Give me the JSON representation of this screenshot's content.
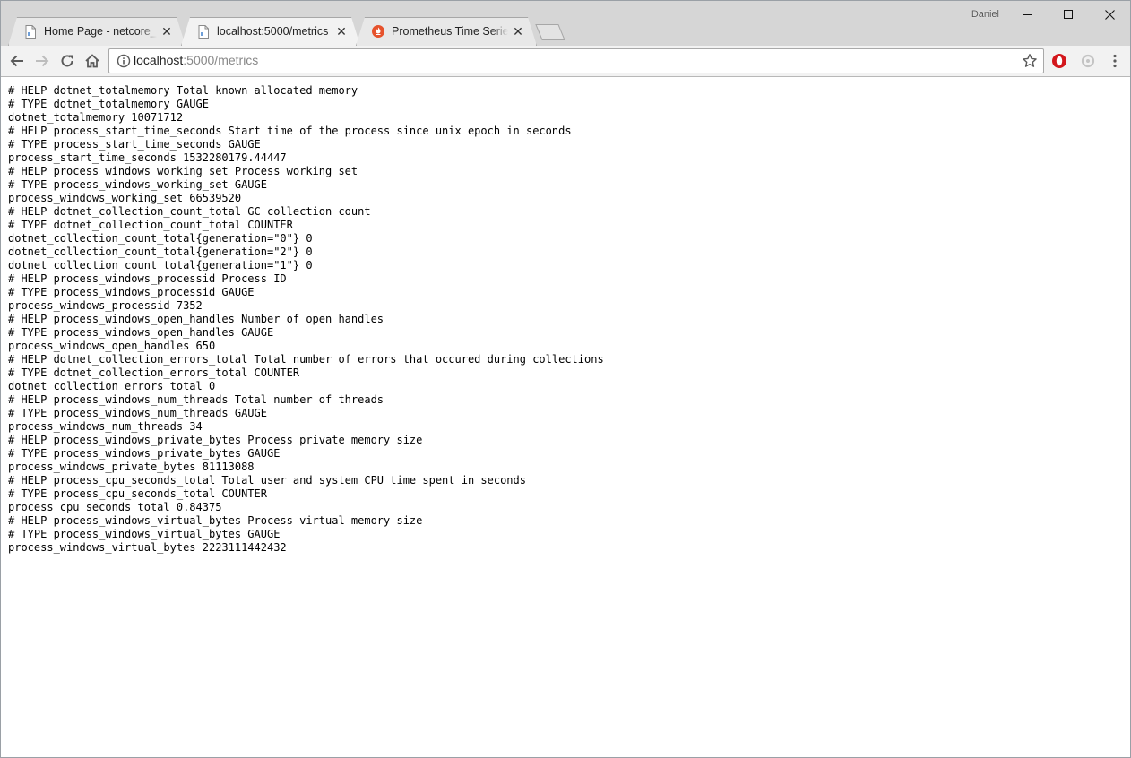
{
  "window": {
    "profile_name": "Daniel"
  },
  "tabs": [
    {
      "title": "Home Page - netcore_prometheus",
      "active": false,
      "favicon": "page-icon"
    },
    {
      "title": "localhost:5000/metrics",
      "active": true,
      "favicon": "page-icon"
    },
    {
      "title": "Prometheus Time Series Collection and Processing Server",
      "active": false,
      "favicon": "prometheus-icon"
    }
  ],
  "address_bar": {
    "host": "localhost",
    "path": ":5000/metrics"
  },
  "metrics_lines": [
    "# HELP dotnet_totalmemory Total known allocated memory",
    "# TYPE dotnet_totalmemory GAUGE",
    "dotnet_totalmemory 10071712",
    "# HELP process_start_time_seconds Start time of the process since unix epoch in seconds",
    "# TYPE process_start_time_seconds GAUGE",
    "process_start_time_seconds 1532280179.44447",
    "# HELP process_windows_working_set Process working set",
    "# TYPE process_windows_working_set GAUGE",
    "process_windows_working_set 66539520",
    "# HELP dotnet_collection_count_total GC collection count",
    "# TYPE dotnet_collection_count_total COUNTER",
    "dotnet_collection_count_total{generation=\"0\"} 0",
    "dotnet_collection_count_total{generation=\"2\"} 0",
    "dotnet_collection_count_total{generation=\"1\"} 0",
    "# HELP process_windows_processid Process ID",
    "# TYPE process_windows_processid GAUGE",
    "process_windows_processid 7352",
    "# HELP process_windows_open_handles Number of open handles",
    "# TYPE process_windows_open_handles GAUGE",
    "process_windows_open_handles 650",
    "# HELP dotnet_collection_errors_total Total number of errors that occured during collections",
    "# TYPE dotnet_collection_errors_total COUNTER",
    "dotnet_collection_errors_total 0",
    "# HELP process_windows_num_threads Total number of threads",
    "# TYPE process_windows_num_threads GAUGE",
    "process_windows_num_threads 34",
    "# HELP process_windows_private_bytes Process private memory size",
    "# TYPE process_windows_private_bytes GAUGE",
    "process_windows_private_bytes 81113088",
    "# HELP process_cpu_seconds_total Total user and system CPU time spent in seconds",
    "# TYPE process_cpu_seconds_total COUNTER",
    "process_cpu_seconds_total 0.84375",
    "# HELP process_windows_virtual_bytes Process virtual memory size",
    "# TYPE process_windows_virtual_bytes GAUGE",
    "process_windows_virtual_bytes 2223111442432"
  ],
  "colors": {
    "titlebar": "#d6d6d6",
    "toolbar": "#f2f2f2",
    "prometheus_accent": "#e6522c",
    "opera_red": "#d3171c"
  }
}
